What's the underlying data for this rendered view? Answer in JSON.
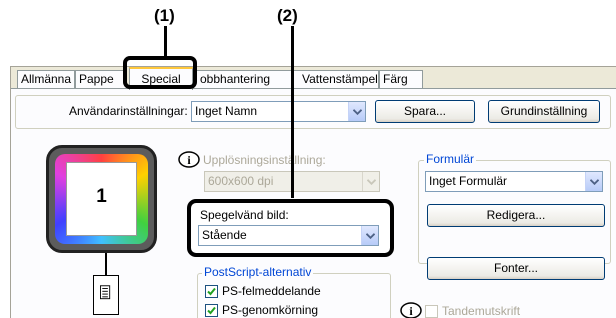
{
  "callouts": {
    "one": "(1)",
    "two": "(2)"
  },
  "tabs": [
    {
      "label": "Allmänna"
    },
    {
      "label": "Pappe"
    },
    {
      "label": "Special"
    },
    {
      "label": "obbhantering"
    },
    {
      "label": "Vattenstämpel"
    },
    {
      "label": "Färg"
    }
  ],
  "user_settings": {
    "label": "Användarinställningar:",
    "value": "Inget Namn",
    "save_label": "Spara...",
    "default_label": "Grundinställning"
  },
  "preview": {
    "page_number": "1",
    "icon": "document-icon"
  },
  "resolution": {
    "label": "Upplösningsinställning:",
    "value": "600x600 dpi"
  },
  "mirror": {
    "label": "Spegelvänd bild:",
    "value": "Stående"
  },
  "postscript": {
    "title": "PostScript-alternativ",
    "options": [
      {
        "label": "PS-felmeddelande",
        "checked": true
      },
      {
        "label": "PS-genomkörning",
        "checked": true
      }
    ]
  },
  "form": {
    "title": "Formulär",
    "value": "Inget Formulär",
    "edit_label": "Redigera..."
  },
  "fonts_label": "Fonter...",
  "tandem": {
    "label": "Tandemutskrift",
    "checked": false
  },
  "colors": {
    "highlight_border": "#000000",
    "active_tab_accent": "#ffc83c",
    "group_title": "#0046d5",
    "dialog_bg": "#ece9d8"
  }
}
